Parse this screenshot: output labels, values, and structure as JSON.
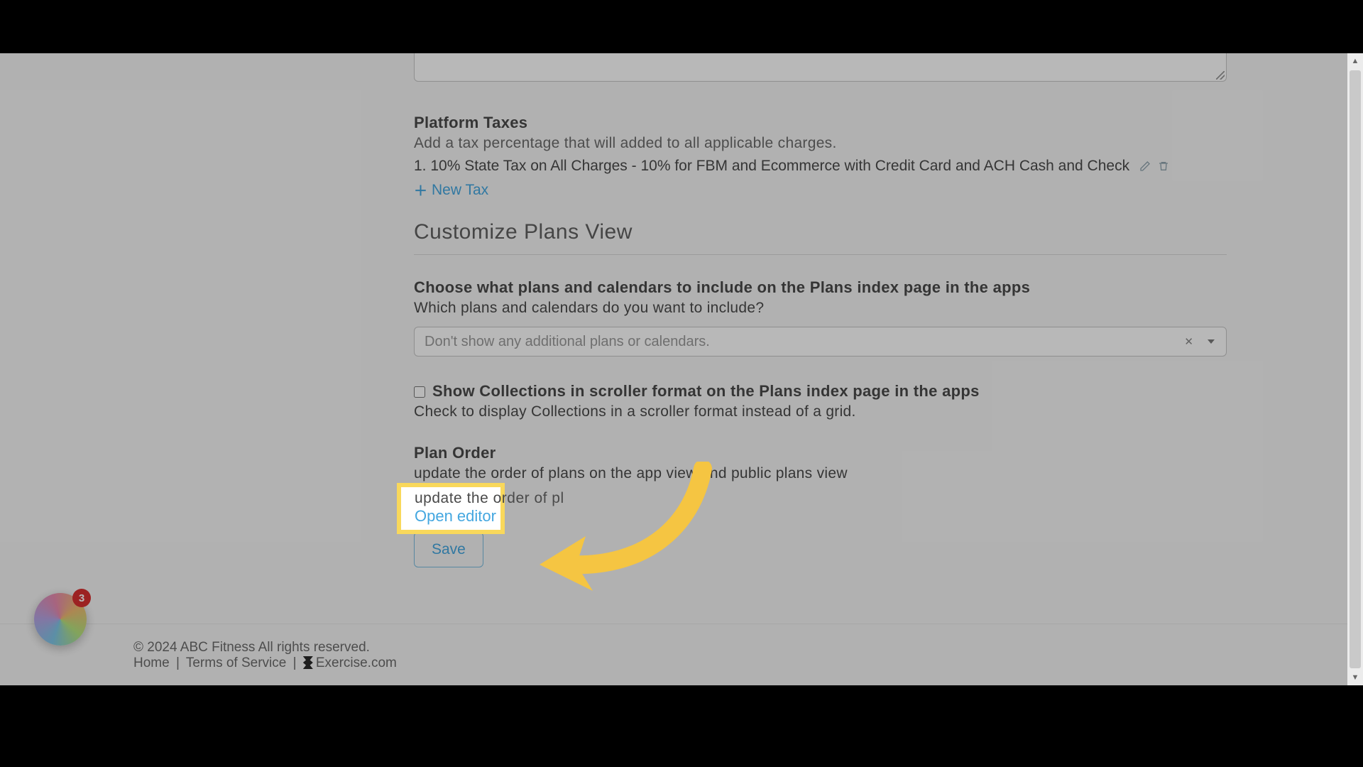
{
  "platform_taxes": {
    "heading": "Platform Taxes",
    "helper": "Add a tax percentage that will added to all applicable charges.",
    "row": "1. 10% State Tax on All Charges - 10% for FBM and Ecommerce with Credit Card and ACH Cash and Check",
    "new_tax_label": "New Tax",
    "edit_icon_name": "pencil-icon",
    "delete_icon_name": "trash-icon"
  },
  "customize_plans": {
    "title": "Customize Plans View",
    "include_heading": "Choose what plans and calendars to include on the Plans index page in the apps",
    "include_helper": "Which plans and calendars do you want to include?",
    "select_placeholder": "Don't show any additional plans or calendars.",
    "show_collections_label": "Show Collections in scroller format on the Plans index page in the apps",
    "show_collections_helper": "Check to display Collections in a scroller format instead of a grid.",
    "plan_order_heading": "Plan Order",
    "plan_order_helper": "update the order of plans on the app view and public plans view",
    "open_editor_label": "Open editor"
  },
  "save_label": "Save",
  "footer": {
    "copyright": "© 2024 ABC Fitness All rights reserved.",
    "home": "Home",
    "terms": "Terms of Service",
    "exercise": "Exercise.com"
  },
  "chat": {
    "badge": "3"
  },
  "spotlight": {
    "partial_text": "update the order of pl",
    "link_text": "Open editor"
  }
}
